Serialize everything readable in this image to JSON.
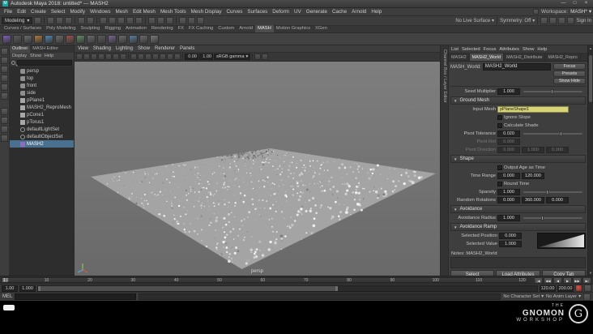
{
  "icons": {
    "caret_down": "▾",
    "triangle_down": "▼",
    "minimize": "—",
    "maximize": "□",
    "close": "×",
    "maya_logo": "M"
  },
  "titlebar": {
    "title": "Autodesk Maya 2018: untitled* --- MASH2"
  },
  "menubar": {
    "items": [
      "File",
      "Edit",
      "Create",
      "Select",
      "Modify",
      "Windows",
      "Mesh",
      "Edit Mesh",
      "Mesh Tools",
      "Mesh Display",
      "Curves",
      "Surfaces",
      "Deform",
      "UV",
      "Generate",
      "Cache",
      "Arnold",
      "Help"
    ],
    "workspace_label": "Workspace:",
    "workspace_value": "MASH*"
  },
  "statusline": {
    "mode_selector": "Modeling",
    "left_icons": [
      "grab-handle",
      "divider",
      "new-scene",
      "open-scene",
      "save-scene",
      "divider",
      "undo",
      "redo",
      "divider",
      "snap-to-grid",
      "snap-to-curve",
      "snap-to-point",
      "snap-to-plane",
      "make-live",
      "divider",
      "input-connections",
      "output-connections",
      "construction-history",
      "divider",
      "render-current-frame",
      "ipr-render",
      "render-settings"
    ],
    "no_live_surface": "No Live Surface",
    "symmetry": "Symmetry: Off",
    "right_icons": [
      "modeling-toolkit",
      "channel-box",
      "attribute-editor",
      "tool-settings"
    ],
    "sign_in": "Sign In"
  },
  "shelf": {
    "tabs": [
      {
        "label": "Curves / Surfaces"
      },
      {
        "label": "Poly Modeling"
      },
      {
        "label": "Sculpting"
      },
      {
        "label": "Rigging"
      },
      {
        "label": "Animation"
      },
      {
        "label": "Rendering"
      },
      {
        "label": "FX"
      },
      {
        "label": "FX Caching"
      },
      {
        "label": "Custom"
      },
      {
        "label": "Arnold"
      },
      {
        "label": "MASH",
        "active": true
      },
      {
        "label": "Motion Graphics"
      },
      {
        "label": "XGen"
      }
    ],
    "icons": [
      {
        "name": "mash-network",
        "color": "#7e5fb5"
      },
      {
        "name": "mash-editor",
        "color": "#5b5b5b"
      },
      {
        "name": "mash-audio",
        "color": "#6b6b6b"
      },
      {
        "name": "mash-breakout",
        "color": "#b07a3c"
      },
      {
        "name": "mash-color",
        "color": "#4f86b0"
      },
      {
        "name": "mash-curve",
        "color": "#6b6b6b"
      },
      {
        "name": "mash-dynamics",
        "color": "#9a524c"
      },
      {
        "name": "mash-falloff",
        "color": "#5e8f62"
      },
      {
        "name": "mash-flight",
        "color": "#6b6b6b"
      },
      {
        "name": "mash-id",
        "color": "#5b5b5b"
      },
      {
        "name": "mash-influence",
        "color": "#77668f"
      },
      {
        "name": "mash-merge",
        "color": "#6b6b6b"
      },
      {
        "name": "mash-offset",
        "color": "#587f9e"
      },
      {
        "name": "mash-orient",
        "color": "#6b6b6b"
      },
      {
        "name": "mash-placer",
        "color": "#7a7a7a"
      }
    ]
  },
  "toolbox": {
    "tools": [
      "select-tool",
      "lasso-tool",
      "paint-select-tool",
      "move-tool",
      "rotate-tool",
      "scale-tool"
    ],
    "layouts": [
      "single-pane-layout",
      "two-pane-layout",
      "four-pane-layout",
      "persp-outliner-layout"
    ]
  },
  "outliner": {
    "tabs": [
      {
        "label": "Outliner",
        "active": true
      },
      {
        "label": "MASH Editor"
      }
    ],
    "menus": [
      "Display",
      "Show",
      "Help"
    ],
    "items": [
      {
        "label": "persp",
        "icon": "camera"
      },
      {
        "label": "top",
        "icon": "camera"
      },
      {
        "label": "front",
        "icon": "camera"
      },
      {
        "label": "side",
        "icon": "camera"
      },
      {
        "label": "pPlane1",
        "icon": "mesh"
      },
      {
        "label": "MASH2_ReproMesh",
        "icon": "mesh"
      },
      {
        "label": "pCone1",
        "icon": "mesh"
      },
      {
        "label": "pTorus1",
        "icon": "mesh"
      },
      {
        "label": "defaultLightSet",
        "icon": "set"
      },
      {
        "label": "defaultObjectSet",
        "icon": "set"
      },
      {
        "label": "MASH2",
        "icon": "mash",
        "selected": true
      }
    ]
  },
  "viewport": {
    "menus": [
      "View",
      "Shading",
      "Lighting",
      "Show",
      "Renderer",
      "Panels"
    ],
    "toolbar_icons_a": [
      "select-camera",
      "lock-camera",
      "camera-attributes",
      "bookmarks",
      "image-plane",
      "2d-pan-zoom",
      "grease-pencil"
    ],
    "toolbar_icons_b": [
      "wireframe",
      "smooth-shade",
      "textured",
      "use-all-lights",
      "shadows",
      "screen-space-ao",
      "motion-blur"
    ],
    "exposure": "0.00",
    "gamma": "1.00",
    "color_space": "sRGB gamma",
    "toolbar_icons_c": [
      "xray",
      "isolate-select"
    ],
    "camera_label": "persp"
  },
  "side_strip": {
    "label": "Channel Box / Layer Editor"
  },
  "attribute_editor": {
    "menus": [
      "List",
      "Selected",
      "Focus",
      "Attributes",
      "Show",
      "Help"
    ],
    "tabs": [
      {
        "label": "MASH2"
      },
      {
        "label": "MASH2_World",
        "active": true
      },
      {
        "label": "MASH2_Distribute"
      },
      {
        "label": "MASH2_Repro"
      }
    ],
    "node_label": "MASH_World:",
    "node_name": "MASH2_World",
    "focus_button": "Focus",
    "presets_button": "Presets",
    "show_hide_button": "Show Hide",
    "seed_multiplier": {
      "label": "Seed Multiplier",
      "value": "1.000"
    },
    "ground_mesh": {
      "header": "Ground Mesh",
      "input_mesh": {
        "label": "Input Mesh",
        "value": "pPlaneShape1"
      },
      "ignore_slope": "Ignore Slope",
      "calculate_shade": "Calculate Shade",
      "pivot_tolerance": {
        "label": "Pivot Tolerance",
        "value": "0.020"
      },
      "pivot_rot": {
        "label": "Pivot Rot",
        "value": "0.000"
      },
      "pivot_direction": {
        "label": "Pivot Direction",
        "values": [
          "0.000",
          "1.000",
          "0.000"
        ]
      }
    },
    "shape": {
      "header": "Shape",
      "output_age": "Output Age as Time",
      "time_range": {
        "label": "Time Range",
        "values": [
          "0.000",
          "120.000"
        ]
      },
      "round_time": "Round Time",
      "sparsity": {
        "label": "Sparsity",
        "value": "1.000"
      },
      "random_rotations": {
        "label": "Random Rotations",
        "values": [
          "0.000",
          "360.000",
          "0.000"
        ]
      }
    },
    "avoidance": {
      "header": "Avoidance",
      "radius": {
        "label": "Avoidance Radius",
        "value": "1.000"
      }
    },
    "avoidance_ramp": {
      "header": "Avoidance Ramp",
      "selected_position": {
        "label": "Selected Position",
        "value": "0.000"
      },
      "selected_value": {
        "label": "Selected Value",
        "value": "1.000"
      }
    },
    "notes_label": "Notes: MASH2_World",
    "footer_buttons": [
      "Select",
      "Load Attributes",
      "Copy Tab"
    ]
  },
  "timeline": {
    "ticks": [
      1,
      10,
      20,
      30,
      40,
      50,
      60,
      70,
      80,
      90,
      100,
      110,
      120
    ],
    "range_start": 1,
    "range_end": 120,
    "current_frame": "1",
    "playback_buttons": [
      {
        "name": "go-to-start",
        "glyph": "|◀"
      },
      {
        "name": "step-back",
        "glyph": "◀◀"
      },
      {
        "name": "play-backwards",
        "glyph": "◀"
      },
      {
        "name": "play-forwards",
        "glyph": "▶"
      },
      {
        "name": "step-forward",
        "glyph": "▶▶"
      },
      {
        "name": "go-to-end",
        "glyph": "▶|"
      }
    ]
  },
  "range_slider": {
    "playback_start": "1.00",
    "anim_start": "1.000",
    "anim_end": "120.00",
    "playback_end": "200.00",
    "right_icons": [
      "auto-keyframe",
      "animation-preferences"
    ]
  },
  "command_line": {
    "label": "MEL",
    "input_value": "",
    "character_set": "No Character Set",
    "anim_layer": "No Anim Layer",
    "right_icons": [
      "script-editor"
    ]
  },
  "watermark": {
    "line1": "THE",
    "line2": "GNOMON",
    "line3": "WORKSHOP",
    "monogram": "G"
  }
}
